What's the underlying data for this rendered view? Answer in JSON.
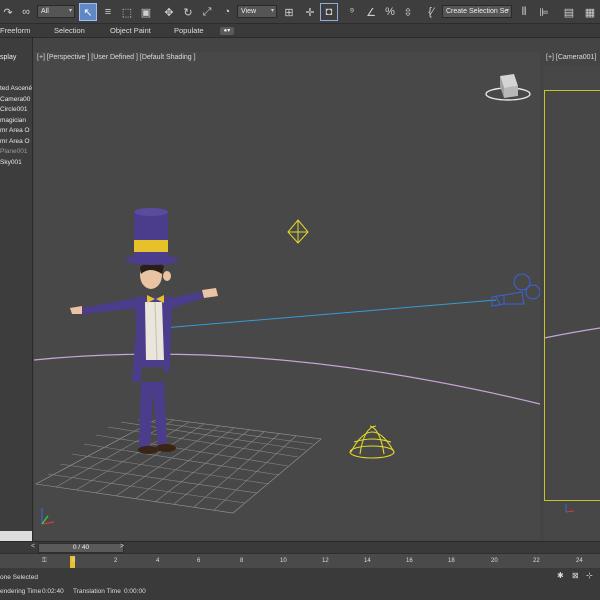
{
  "toolbar": {
    "filter_value": "All",
    "view_value": "View",
    "selection_set_placeholder": "Create Selection Se"
  },
  "ribbon": {
    "tabs": [
      "Freeform",
      "Selection",
      "Object Paint",
      "Populate"
    ],
    "toggle": "●▾"
  },
  "left_panel": {
    "tab_label": "splay",
    "items": [
      {
        "label": "ted Ascené",
        "dim": false
      },
      {
        "label": "Camera00",
        "dim": false
      },
      {
        "label": "Circle001",
        "dim": false
      },
      {
        "label": "magician",
        "dim": false
      },
      {
        "label": "mr Area O",
        "dim": false
      },
      {
        "label": "mr Area O",
        "dim": false
      },
      {
        "label": "Plane001",
        "dim": true
      },
      {
        "label": "Sky001",
        "dim": false
      }
    ]
  },
  "viewport_main": {
    "label": "[+] [Perspective ] [User Defined ] [Default Shading ]"
  },
  "viewport_side": {
    "label": "[+] [Camera001]"
  },
  "timeline": {
    "slider_text": "0 / 40",
    "prev": "<",
    "next": ">",
    "ticks": [
      "0",
      "2",
      "4",
      "6",
      "8",
      "10",
      "12",
      "14",
      "16",
      "18",
      "20",
      "22",
      "24"
    ]
  },
  "status": {
    "selection": "one Selected",
    "rendering_label": "endering Time",
    "rendering_value": "0:02:40",
    "translation_label": "Translation Time",
    "translation_value": "0:00:00"
  },
  "colors": {
    "selection_yellow": "#c9c22a",
    "active_blue": "#5f88c4",
    "helper_yellow": "#e6d92a",
    "camera_blue": "#3a64d8"
  }
}
